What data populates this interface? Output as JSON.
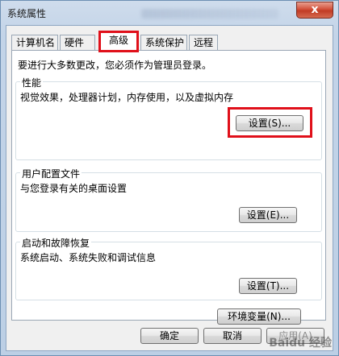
{
  "window": {
    "title": "系统属性",
    "close_glyph": "x"
  },
  "tabs": [
    {
      "label": "计算机名"
    },
    {
      "label": "硬件"
    },
    {
      "label": "高级"
    },
    {
      "label": "系统保护"
    },
    {
      "label": "远程"
    }
  ],
  "advanced": {
    "admin_note": "要进行大多数更改，您必须作为管理员登录。",
    "performance": {
      "title": "性能",
      "desc": "视觉效果，处理器计划，内存使用，以及虚拟内存",
      "button": "设置(S)..."
    },
    "profiles": {
      "title": "用户配置文件",
      "desc": "与您登录有关的桌面设置",
      "button": "设置(E)..."
    },
    "startup": {
      "title": "启动和故障恢复",
      "desc": "系统启动、系统失败和调试信息",
      "button": "设置(T)..."
    },
    "env_button": "环境变量(N)..."
  },
  "footer": {
    "ok": "确定",
    "cancel": "取消",
    "apply": "应用(A)"
  },
  "watermark": "Baidu 经验"
}
